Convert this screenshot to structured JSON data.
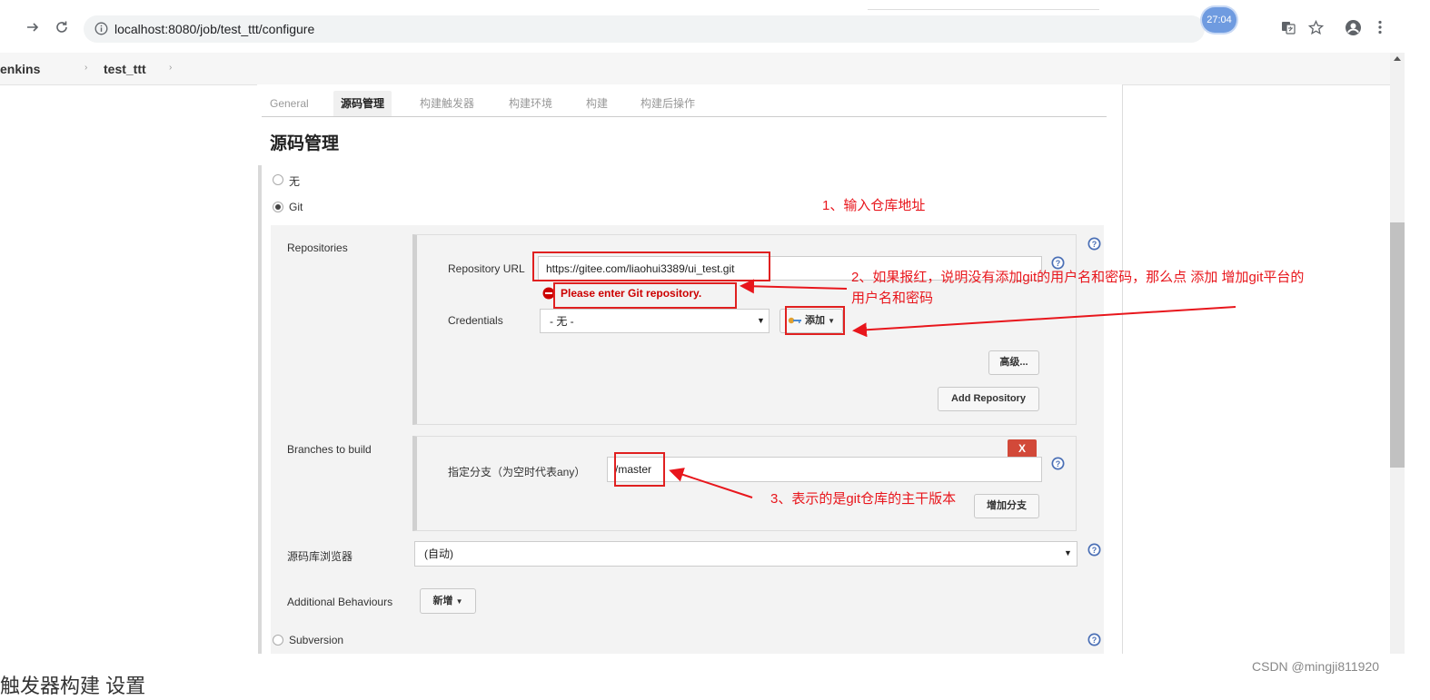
{
  "browser": {
    "url": "localhost:8080/job/test_ttt/configure",
    "badge": "27:04"
  },
  "breadcrumb": {
    "items": [
      "enkins",
      "test_ttt"
    ]
  },
  "tabs": [
    {
      "label": "General",
      "active": false
    },
    {
      "label": "源码管理",
      "active": true
    },
    {
      "label": "构建触发器",
      "active": false
    },
    {
      "label": "构建环境",
      "active": false
    },
    {
      "label": "构建",
      "active": false
    },
    {
      "label": "构建后操作",
      "active": false
    }
  ],
  "section": {
    "title": "源码管理",
    "scm_options": [
      {
        "label": "无",
        "checked": false
      },
      {
        "label": "Git",
        "checked": true
      },
      {
        "label": "Subversion",
        "checked": false
      }
    ]
  },
  "repositories": {
    "label": "Repositories",
    "url_label": "Repository URL",
    "url_value": "https://gitee.com/liaohui3389/ui_test.git",
    "error": "Please enter Git repository.",
    "credentials_label": "Credentials",
    "credentials_value": "- 无 -",
    "add_label": "添加",
    "advanced_label": "高级...",
    "add_repository_label": "Add Repository"
  },
  "branches": {
    "label": "Branches to build",
    "remove_label": "X",
    "branch_label": "指定分支（为空时代表any）",
    "branch_value": "/master",
    "add_branch_label": "增加分支"
  },
  "browser_select": {
    "label": "源码库浏览器",
    "value": "(自动)"
  },
  "behaviours": {
    "label": "Additional Behaviours",
    "add_label": "新增"
  },
  "annotations": {
    "a1": "1、输入仓库地址",
    "a2_line1": "2、如果报红，说明没有添加git的用户名和密码，那么点 添加 增加git平台的",
    "a2_line2": "用户名和密码",
    "a3": "3、表示的是git仓库的主干版本"
  },
  "bottom_heading": "触发器构建 设置",
  "watermark": "CSDN @mingji811920",
  "colors": {
    "annotation_red": "#e8161c",
    "error_red": "#cc0000",
    "help_blue": "#4a6fb5",
    "remove_red": "#d24939"
  }
}
